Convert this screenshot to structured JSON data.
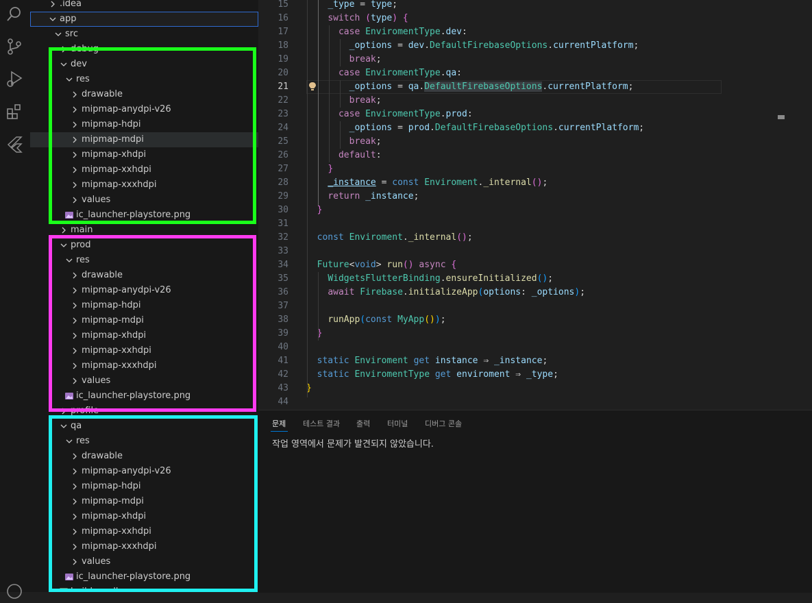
{
  "activity_bar": {
    "icons": [
      "search-icon",
      "source-control-icon",
      "run-debug-icon",
      "extensions-icon",
      "flutter-icon"
    ]
  },
  "explorer": {
    "rows": [
      {
        "label": ".idea",
        "kind": "folder-collapsed"
      },
      {
        "label": "app",
        "kind": "folder-expanded"
      },
      {
        "label": "src",
        "kind": "folder-expanded"
      },
      {
        "label": "debug",
        "kind": "folder-collapsed"
      },
      {
        "label": "dev",
        "kind": "folder-expanded"
      },
      {
        "label": "res",
        "kind": "folder-expanded"
      },
      {
        "label": "drawable",
        "kind": "folder-collapsed"
      },
      {
        "label": "mipmap-anydpi-v26",
        "kind": "folder-collapsed"
      },
      {
        "label": "mipmap-hdpi",
        "kind": "folder-collapsed"
      },
      {
        "label": "mipmap-mdpi",
        "kind": "folder-collapsed"
      },
      {
        "label": "mipmap-xhdpi",
        "kind": "folder-collapsed"
      },
      {
        "label": "mipmap-xxhdpi",
        "kind": "folder-collapsed"
      },
      {
        "label": "mipmap-xxxhdpi",
        "kind": "folder-collapsed"
      },
      {
        "label": "values",
        "kind": "folder-collapsed"
      },
      {
        "label": "ic_launcher-playstore.png",
        "kind": "image-file"
      },
      {
        "label": "main",
        "kind": "folder-collapsed"
      },
      {
        "label": "prod",
        "kind": "folder-expanded"
      },
      {
        "label": "res",
        "kind": "folder-expanded"
      },
      {
        "label": "drawable",
        "kind": "folder-collapsed"
      },
      {
        "label": "mipmap-anydpi-v26",
        "kind": "folder-collapsed"
      },
      {
        "label": "mipmap-hdpi",
        "kind": "folder-collapsed"
      },
      {
        "label": "mipmap-mdpi",
        "kind": "folder-collapsed"
      },
      {
        "label": "mipmap-xhdpi",
        "kind": "folder-collapsed"
      },
      {
        "label": "mipmap-xxhdpi",
        "kind": "folder-collapsed"
      },
      {
        "label": "mipmap-xxxhdpi",
        "kind": "folder-collapsed"
      },
      {
        "label": "values",
        "kind": "folder-collapsed"
      },
      {
        "label": "ic_launcher-playstore.png",
        "kind": "image-file"
      },
      {
        "label": "profile",
        "kind": "folder-collapsed"
      },
      {
        "label": "qa",
        "kind": "folder-expanded"
      },
      {
        "label": "res",
        "kind": "folder-expanded"
      },
      {
        "label": "drawable",
        "kind": "folder-collapsed"
      },
      {
        "label": "mipmap-anydpi-v26",
        "kind": "folder-collapsed"
      },
      {
        "label": "mipmap-hdpi",
        "kind": "folder-collapsed"
      },
      {
        "label": "mipmap-mdpi",
        "kind": "folder-collapsed"
      },
      {
        "label": "mipmap-xhdpi",
        "kind": "folder-collapsed"
      },
      {
        "label": "mipmap-xxhdpi",
        "kind": "folder-collapsed"
      },
      {
        "label": "mipmap-xxxhdpi",
        "kind": "folder-collapsed"
      },
      {
        "label": "values",
        "kind": "folder-collapsed"
      },
      {
        "label": "ic_launcher-playstore.png",
        "kind": "image-file"
      },
      {
        "label": "build.gradle",
        "kind": "file"
      }
    ],
    "highlight_colors": {
      "dev": "#1aff1a",
      "prod": "#ff3bf0",
      "qa": "#1ff0f0"
    }
  },
  "editor": {
    "current_line": 21,
    "lines": [
      {
        "n": 15,
        "t": [
          [
            "    ",
            ""
          ],
          [
            "_type",
            "var"
          ],
          [
            " = ",
            "plain"
          ],
          [
            "type",
            "var"
          ],
          [
            ";",
            "plain"
          ]
        ]
      },
      {
        "n": 16,
        "t": [
          [
            "    ",
            ""
          ],
          [
            "switch",
            "kw"
          ],
          [
            " ",
            ""
          ],
          [
            "(",
            "p2"
          ],
          [
            "type",
            "var"
          ],
          [
            ")",
            "p2"
          ],
          [
            " ",
            ""
          ],
          [
            "{",
            "p2"
          ]
        ]
      },
      {
        "n": 17,
        "t": [
          [
            "      ",
            ""
          ],
          [
            "case",
            "kw"
          ],
          [
            " ",
            ""
          ],
          [
            "EnviromentType",
            "type"
          ],
          [
            ".",
            "plain"
          ],
          [
            "dev",
            "var"
          ],
          [
            ":",
            "plain"
          ]
        ]
      },
      {
        "n": 18,
        "t": [
          [
            "        ",
            ""
          ],
          [
            "_options",
            "var"
          ],
          [
            " = ",
            "plain"
          ],
          [
            "dev",
            "var"
          ],
          [
            ".",
            "plain"
          ],
          [
            "DefaultFirebaseOptions",
            "type"
          ],
          [
            ".",
            "plain"
          ],
          [
            "currentPlatform",
            "var"
          ],
          [
            ";",
            "plain"
          ]
        ]
      },
      {
        "n": 19,
        "t": [
          [
            "        ",
            ""
          ],
          [
            "break",
            "kw"
          ],
          [
            ";",
            "plain"
          ]
        ]
      },
      {
        "n": 20,
        "t": [
          [
            "      ",
            ""
          ],
          [
            "case",
            "kw"
          ],
          [
            " ",
            ""
          ],
          [
            "EnviromentType",
            "type"
          ],
          [
            ".",
            "plain"
          ],
          [
            "qa",
            "var"
          ],
          [
            ":",
            "plain"
          ]
        ]
      },
      {
        "n": 21,
        "t": [
          [
            "        ",
            ""
          ],
          [
            "_options",
            "var"
          ],
          [
            " = ",
            "plain"
          ],
          [
            "qa",
            "var"
          ],
          [
            ".",
            "plain"
          ],
          [
            "DefaultFirebaseOptions",
            "type-sel"
          ],
          [
            ".",
            "plain"
          ],
          [
            "currentPlatform",
            "var"
          ],
          [
            ";",
            "plain"
          ]
        ]
      },
      {
        "n": 22,
        "t": [
          [
            "        ",
            ""
          ],
          [
            "break",
            "kw"
          ],
          [
            ";",
            "plain"
          ]
        ]
      },
      {
        "n": 23,
        "t": [
          [
            "      ",
            ""
          ],
          [
            "case",
            "kw"
          ],
          [
            " ",
            ""
          ],
          [
            "EnviromentType",
            "type"
          ],
          [
            ".",
            "plain"
          ],
          [
            "prod",
            "var"
          ],
          [
            ":",
            "plain"
          ]
        ]
      },
      {
        "n": 24,
        "t": [
          [
            "        ",
            ""
          ],
          [
            "_options",
            "var"
          ],
          [
            " = ",
            "plain"
          ],
          [
            "prod",
            "var"
          ],
          [
            ".",
            "plain"
          ],
          [
            "DefaultFirebaseOptions",
            "type"
          ],
          [
            ".",
            "plain"
          ],
          [
            "currentPlatform",
            "var"
          ],
          [
            ";",
            "plain"
          ]
        ]
      },
      {
        "n": 25,
        "t": [
          [
            "        ",
            ""
          ],
          [
            "break",
            "kw"
          ],
          [
            ";",
            "plain"
          ]
        ]
      },
      {
        "n": 26,
        "t": [
          [
            "      ",
            ""
          ],
          [
            "default",
            "kw"
          ],
          [
            ":",
            "plain"
          ]
        ]
      },
      {
        "n": 27,
        "t": [
          [
            "    ",
            ""
          ],
          [
            "}",
            "p2"
          ]
        ]
      },
      {
        "n": 28,
        "t": [
          [
            "    ",
            ""
          ],
          [
            "_instance",
            "var-u"
          ],
          [
            " = ",
            "plain"
          ],
          [
            "const",
            "blue"
          ],
          [
            " ",
            ""
          ],
          [
            "Enviroment",
            "type"
          ],
          [
            ".",
            "plain"
          ],
          [
            "_internal",
            "fn"
          ],
          [
            "()",
            "p2"
          ],
          [
            ";",
            "plain"
          ]
        ]
      },
      {
        "n": 29,
        "t": [
          [
            "    ",
            ""
          ],
          [
            "return",
            "kw"
          ],
          [
            " ",
            ""
          ],
          [
            "_instance",
            "var"
          ],
          [
            ";",
            "plain"
          ]
        ]
      },
      {
        "n": 30,
        "t": [
          [
            "  ",
            ""
          ],
          [
            "}",
            "p2"
          ]
        ]
      },
      {
        "n": 31,
        "t": []
      },
      {
        "n": 32,
        "t": [
          [
            "  ",
            ""
          ],
          [
            "const",
            "blue"
          ],
          [
            " ",
            ""
          ],
          [
            "Enviroment",
            "type"
          ],
          [
            ".",
            "plain"
          ],
          [
            "_internal",
            "fn"
          ],
          [
            "()",
            "p2"
          ],
          [
            ";",
            "plain"
          ]
        ]
      },
      {
        "n": 33,
        "t": []
      },
      {
        "n": 34,
        "t": [
          [
            "  ",
            ""
          ],
          [
            "Future",
            "type"
          ],
          [
            "<",
            "plain"
          ],
          [
            "void",
            "blue"
          ],
          [
            "> ",
            "plain"
          ],
          [
            "run",
            "fn"
          ],
          [
            "()",
            "p2"
          ],
          [
            " ",
            ""
          ],
          [
            "async",
            "kw"
          ],
          [
            " ",
            ""
          ],
          [
            "{",
            "p2"
          ]
        ]
      },
      {
        "n": 35,
        "t": [
          [
            "    ",
            ""
          ],
          [
            "WidgetsFlutterBinding",
            "type"
          ],
          [
            ".",
            "plain"
          ],
          [
            "ensureInitialized",
            "fn"
          ],
          [
            "()",
            "p3"
          ],
          [
            ";",
            "plain"
          ]
        ]
      },
      {
        "n": 36,
        "t": [
          [
            "    ",
            ""
          ],
          [
            "await",
            "kw"
          ],
          [
            " ",
            ""
          ],
          [
            "Firebase",
            "type"
          ],
          [
            ".",
            "plain"
          ],
          [
            "initializeApp",
            "fn"
          ],
          [
            "(",
            "p3"
          ],
          [
            "options",
            "var"
          ],
          [
            ": ",
            "plain"
          ],
          [
            "_options",
            "var"
          ],
          [
            ")",
            "p3"
          ],
          [
            ";",
            "plain"
          ]
        ]
      },
      {
        "n": 37,
        "t": []
      },
      {
        "n": 38,
        "t": [
          [
            "    ",
            ""
          ],
          [
            "runApp",
            "fn"
          ],
          [
            "(",
            "p3"
          ],
          [
            "const",
            "blue"
          ],
          [
            " ",
            ""
          ],
          [
            "MyApp",
            "type"
          ],
          [
            "()",
            "p1"
          ],
          [
            ")",
            "p3"
          ],
          [
            ";",
            "plain"
          ]
        ]
      },
      {
        "n": 39,
        "t": [
          [
            "  ",
            ""
          ],
          [
            "}",
            "p2"
          ]
        ]
      },
      {
        "n": 40,
        "t": []
      },
      {
        "n": 41,
        "t": [
          [
            "  ",
            ""
          ],
          [
            "static",
            "blue"
          ],
          [
            " ",
            ""
          ],
          [
            "Enviroment",
            "type"
          ],
          [
            " ",
            ""
          ],
          [
            "get",
            "blue"
          ],
          [
            " ",
            ""
          ],
          [
            "instance",
            "var"
          ],
          [
            " ⇒ ",
            "plain"
          ],
          [
            "_instance",
            "var"
          ],
          [
            ";",
            "plain"
          ]
        ]
      },
      {
        "n": 42,
        "t": [
          [
            "  ",
            ""
          ],
          [
            "static",
            "blue"
          ],
          [
            " ",
            ""
          ],
          [
            "EnviromentType",
            "type"
          ],
          [
            " ",
            ""
          ],
          [
            "get",
            "blue"
          ],
          [
            " ",
            ""
          ],
          [
            "enviroment",
            "var"
          ],
          [
            " ⇒ ",
            "plain"
          ],
          [
            "_type",
            "var"
          ],
          [
            ";",
            "plain"
          ]
        ]
      },
      {
        "n": 43,
        "t": [
          [
            "}",
            "p1"
          ]
        ]
      },
      {
        "n": 44,
        "t": []
      }
    ]
  },
  "panel": {
    "tabs": [
      "문제",
      "테스트 결과",
      "출력",
      "터미널",
      "디버그 콘솔"
    ],
    "active_tab": "문제",
    "message": "작업 영역에서 문제가 발견되지 않았습니다."
  }
}
